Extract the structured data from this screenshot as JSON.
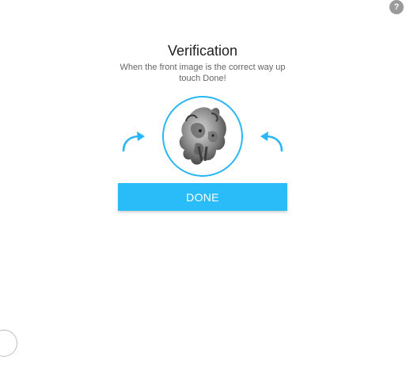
{
  "help": {
    "label": "?"
  },
  "verification": {
    "title": "Verification",
    "instruction_line1": "When the front image is the correct way up",
    "instruction_line2": "touch Done!",
    "done_label": "DONE"
  },
  "icons": {
    "rotate_left": "rotate-left-arrow-icon",
    "rotate_right": "rotate-right-arrow-icon",
    "help": "question-mark-icon",
    "loading": "loading-spinner-icon"
  },
  "colors": {
    "accent": "#29bcf8",
    "ring": "#29b6f6",
    "title": "#202020",
    "subtitle": "#666666",
    "help_bg": "#9a9a9a"
  }
}
